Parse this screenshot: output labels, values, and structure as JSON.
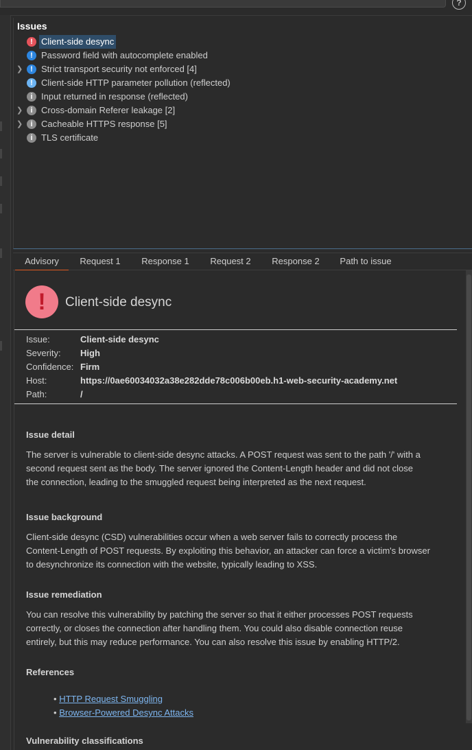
{
  "topbar": {
    "help_glyph": "?"
  },
  "issues": {
    "title": "Issues",
    "items": [
      {
        "label": "Client-side desync",
        "severity": "high",
        "glyph": "!",
        "expandable": false,
        "selected": true
      },
      {
        "label": "Password field with autocomplete enabled",
        "severity": "med",
        "glyph": "!",
        "expandable": false
      },
      {
        "label": "Strict transport security not enforced [4]",
        "severity": "med",
        "glyph": "!",
        "expandable": true
      },
      {
        "label": "Client-side HTTP parameter pollution (reflected)",
        "severity": "low",
        "glyph": "!",
        "expandable": false
      },
      {
        "label": "Input returned in response (reflected)",
        "severity": "info",
        "glyph": "i",
        "expandable": false
      },
      {
        "label": "Cross-domain Referer leakage [2]",
        "severity": "info",
        "glyph": "i",
        "expandable": true
      },
      {
        "label": "Cacheable HTTPS response [5]",
        "severity": "info",
        "glyph": "i",
        "expandable": true
      },
      {
        "label": "TLS certificate",
        "severity": "info",
        "glyph": "i",
        "expandable": false
      }
    ]
  },
  "tabs": {
    "advisory": "Advisory",
    "request1": "Request 1",
    "response1": "Response 1",
    "request2": "Request 2",
    "response2": "Response 2",
    "path": "Path to issue"
  },
  "advisory": {
    "icon_glyph": "!",
    "title": "Client-side desync",
    "fields": {
      "issue_k": "Issue:",
      "issue_v": "Client-side desync",
      "severity_k": "Severity:",
      "severity_v": "High",
      "confidence_k": "Confidence:",
      "confidence_v": "Firm",
      "host_k": "Host:",
      "host_v": "https://0ae60034032a38e282dde78c006b00eb.h1-web-security-academy.net",
      "path_k": "Path:",
      "path_v": "/"
    },
    "detail_h": "Issue detail",
    "detail_lines": [
      "The server is vulnerable to client-side desync attacks. A POST request was sent to the path '/' with a",
      "second request sent as the body. The server ignored the Content-Length header and did not close",
      "the connection, leading to the smuggled request being interpreted as the next request."
    ],
    "background_h": "Issue background",
    "background_lines": [
      "Client-side desync (CSD) vulnerabilities occur when a web server fails to correctly process the",
      "Content-Length of POST requests. By exploiting this behavior, an attacker can force a victim's browser",
      "to desynchronize its connection with the website, typically leading to XSS."
    ],
    "remediation_h": "Issue remediation",
    "remediation_lines": [
      "You can resolve this vulnerability by patching the server so that it either processes POST requests",
      "correctly, or closes the connection after handling them. You could also disable connection reuse",
      "entirely, but this may reduce performance. You can also resolve this issue by enabling HTTP/2."
    ],
    "references_h": "References",
    "bullet": "•",
    "ref1": "HTTP Request Smuggling",
    "ref2": "Browser-Powered Desync Attacks",
    "vuln_h": "Vulnerability classifications"
  },
  "colors": {
    "high": "#e5535b",
    "medium": "#2d86e0",
    "low": "#6db4f2",
    "info": "#8c8c8c",
    "selection": "#2f4d69",
    "active_tab": "#e05a22",
    "link": "#7eb6f0"
  }
}
